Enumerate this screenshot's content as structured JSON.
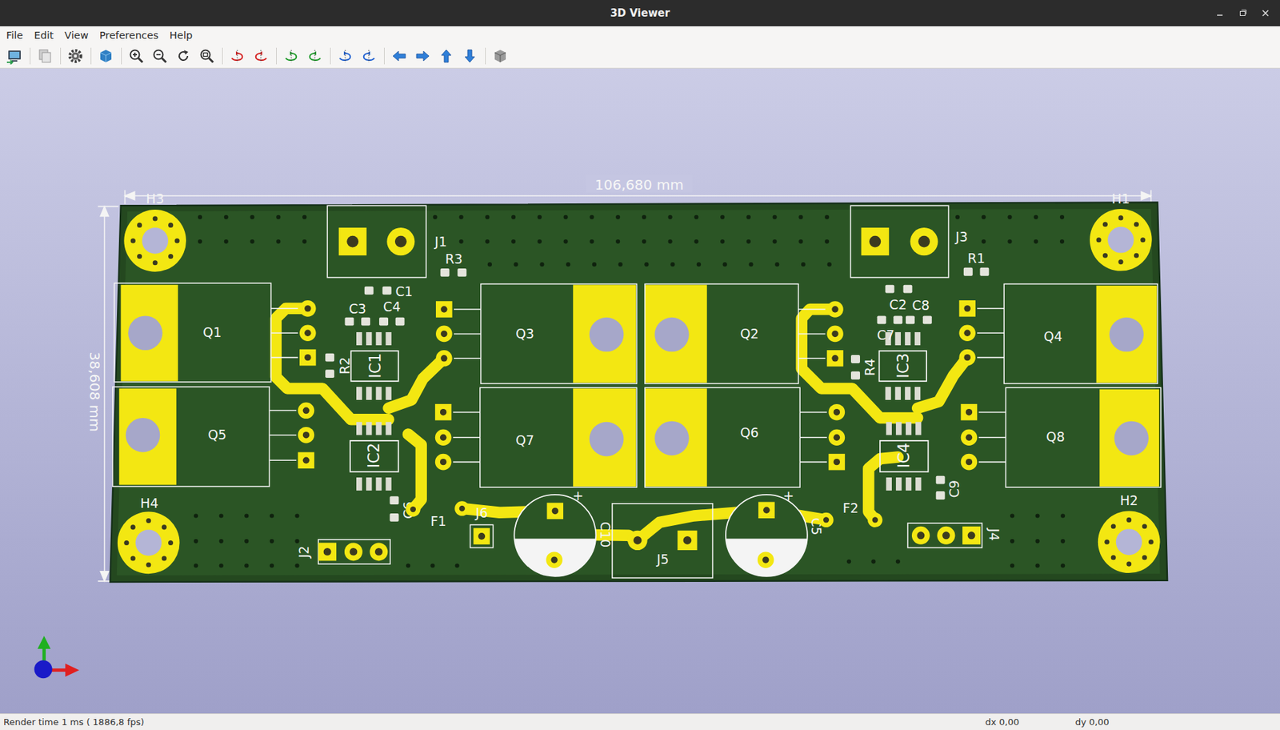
{
  "window": {
    "title": "3D Viewer"
  },
  "menu": [
    "File",
    "Edit",
    "View",
    "Preferences",
    "Help"
  ],
  "dimensions": {
    "width": "106,680 mm",
    "height": "38,608 mm"
  },
  "components": [
    {
      "ref": "H3",
      "kind": "hole"
    },
    {
      "ref": "H1",
      "kind": "hole"
    },
    {
      "ref": "H4",
      "kind": "hole"
    },
    {
      "ref": "H2",
      "kind": "hole"
    },
    {
      "ref": "Q1",
      "kind": "transistor"
    },
    {
      "ref": "Q5",
      "kind": "transistor"
    },
    {
      "ref": "Q3",
      "kind": "transistor"
    },
    {
      "ref": "Q2",
      "kind": "transistor"
    },
    {
      "ref": "Q7",
      "kind": "transistor"
    },
    {
      "ref": "Q6",
      "kind": "transistor"
    },
    {
      "ref": "Q4",
      "kind": "transistor"
    },
    {
      "ref": "Q8",
      "kind": "transistor"
    },
    {
      "ref": "J1",
      "kind": "connector"
    },
    {
      "ref": "J3",
      "kind": "connector"
    },
    {
      "ref": "J5",
      "kind": "connector"
    },
    {
      "ref": "J2",
      "kind": "connector"
    },
    {
      "ref": "J4",
      "kind": "connector"
    },
    {
      "ref": "J6",
      "kind": "connector"
    },
    {
      "ref": "C10",
      "kind": "electrolytic",
      "polarity": "+"
    },
    {
      "ref": "C5",
      "kind": "electrolytic",
      "polarity": "+"
    },
    {
      "ref": "IC1",
      "kind": "ic"
    },
    {
      "ref": "IC2",
      "kind": "ic"
    },
    {
      "ref": "IC3",
      "kind": "ic"
    },
    {
      "ref": "IC4",
      "kind": "ic"
    },
    {
      "ref": "C1",
      "kind": "passive"
    },
    {
      "ref": "C3",
      "kind": "passive"
    },
    {
      "ref": "C4",
      "kind": "passive"
    },
    {
      "ref": "R3",
      "kind": "passive"
    },
    {
      "ref": "R2",
      "kind": "passive"
    },
    {
      "ref": "C6",
      "kind": "passive"
    },
    {
      "ref": "C2",
      "kind": "passive"
    },
    {
      "ref": "C8",
      "kind": "passive"
    },
    {
      "ref": "C7",
      "kind": "passive"
    },
    {
      "ref": "R1",
      "kind": "passive"
    },
    {
      "ref": "R4",
      "kind": "passive"
    },
    {
      "ref": "C9",
      "kind": "passive"
    },
    {
      "ref": "F1",
      "kind": "fuse"
    },
    {
      "ref": "F2",
      "kind": "fuse"
    }
  ],
  "status_bar": {
    "render_time": "Render time 1 ms ( 1886,8 fps)",
    "dx": "dx 0,00",
    "dy": "dy 0,00"
  }
}
